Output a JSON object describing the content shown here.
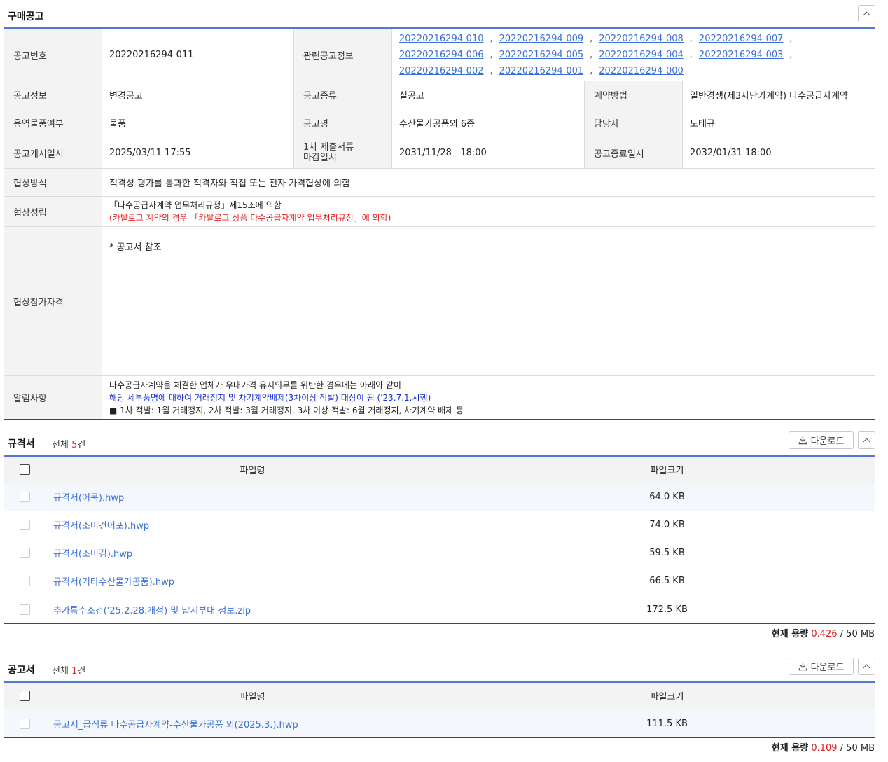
{
  "purchase": {
    "title": "구매공고",
    "rows": {
      "notice_no_label": "공고번호",
      "notice_no": "20220216294-011",
      "related_label": "관련공고정보",
      "related": [
        "20220216294-010",
        "20220216294-009",
        "20220216294-008",
        "20220216294-007",
        "20220216294-006",
        "20220216294-005",
        "20220216294-004",
        "20220216294-003",
        "20220216294-002",
        "20220216294-001",
        "20220216294-000"
      ],
      "separator": ",",
      "info_label": "공고정보",
      "info": "변경공고",
      "kind_label": "공고종류",
      "kind": "실공고",
      "contract_label": "계약방법",
      "contract": "일반경쟁(제3자단가계약) 다수공급자계약",
      "goods_label": "용역물품여부",
      "goods": "물품",
      "name_label": "공고명",
      "name": "수산물가공품외 6종",
      "manager_label": "담당자",
      "manager": "노태규",
      "posted_label": "공고게시일시",
      "posted": "2025/03/11 17:55",
      "deadline_label_1": "1차 제출서류",
      "deadline_label_2": "마감일시",
      "deadline": "2031/11/28   18:00",
      "end_label": "공고종료일시",
      "end": "2032/01/31 18:00",
      "method_label": "협상방식",
      "method": "적격성 평가를 통과한 적격자와 직접 또는 전자 가격협상에 의함",
      "establish_label": "협상성립",
      "establish_1": "「다수공급자계약 업무처리규정」제15조에 의함",
      "establish_2": "(카탈로그 계약의 경우 「카탈로그 상품 다수공급자계약 업무처리규정」에 의함)",
      "qual_label": "협상참가자격",
      "qual": "* 공고서 참조",
      "notice_label": "알림사항",
      "notice_1": "다수공급자계약을 체결한 업체가 우대가격 유지의무를 위반한 경우에는 아래와 같이",
      "notice_2": "해당 세부품명에 대하여 거래정지 및 차기계약배제(3차이상 적발) 대상이 됨 ('23.7.1.시행)",
      "notice_3": "■ 1차 적발: 1월 거래정지, 2차 적발: 3월 거래정지, 3차 이상 적발: 6월 거래정지, 차기계약 배제 등"
    }
  },
  "spec": {
    "title": "규격서",
    "count_prefix": "전체",
    "count": "5",
    "count_suffix": "건",
    "download": "다운로드",
    "col_name": "파일명",
    "col_size": "파일크기",
    "files": [
      {
        "name": "규격서(어묵).hwp",
        "size": "64.0 KB"
      },
      {
        "name": "규격서(조미건어포).hwp",
        "size": "74.0 KB"
      },
      {
        "name": "규격서(조미김).hwp",
        "size": "59.5 KB"
      },
      {
        "name": "규격서(기타수산물가공품).hwp",
        "size": "66.5 KB"
      },
      {
        "name": "추가특수조건('25.2.28.개정) 및 납지부대 정보.zip",
        "size": "172.5 KB"
      }
    ],
    "usage_label": "현재 용량",
    "usage_value": "0.426",
    "usage_total": "/ 50 MB"
  },
  "notice_doc": {
    "title": "공고서",
    "count_prefix": "전체",
    "count": "1",
    "count_suffix": "건",
    "download": "다운로드",
    "col_name": "파일명",
    "col_size": "파일크기",
    "files": [
      {
        "name": "공고서_급식류 다수공급자계약-수산물가공품 외(2025.3.).hwp",
        "size": "111.5 KB"
      }
    ],
    "usage_label": "현재 용량",
    "usage_value": "0.109",
    "usage_total": "/ 50 MB"
  },
  "icons": {
    "collapse": "chevron-up-icon",
    "download": "download-icon",
    "checkbox": "checkbox-icon"
  }
}
